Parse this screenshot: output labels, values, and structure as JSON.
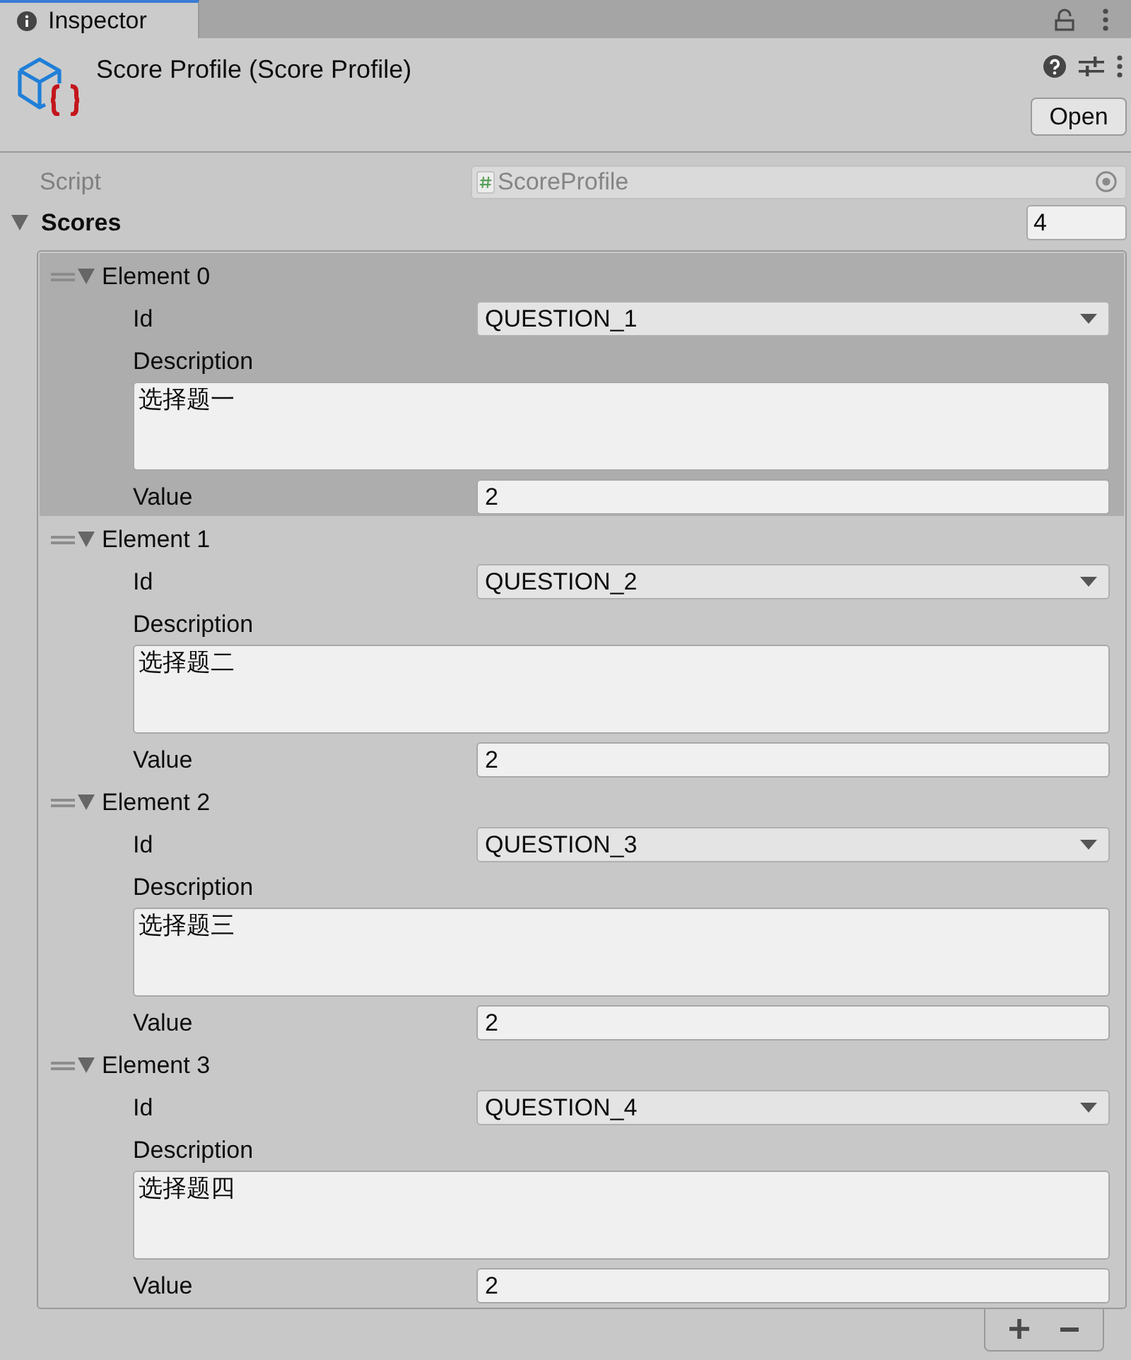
{
  "tab": {
    "label": "Inspector",
    "selected": true
  },
  "header": {
    "title": "Score Profile (Score Profile)",
    "open_button": "Open"
  },
  "script": {
    "label": "Script",
    "value": "ScoreProfile",
    "disabled": true
  },
  "scores": {
    "label": "Scores",
    "expanded": true,
    "size": "4",
    "elements": [
      {
        "label": "Element 0",
        "selected": true,
        "expanded": true,
        "id_label": "Id",
        "id": "QUESTION_1",
        "description_label": "Description",
        "description": "选择题一",
        "value_label": "Value",
        "value": "2"
      },
      {
        "label": "Element 1",
        "selected": false,
        "expanded": true,
        "id_label": "Id",
        "id": "QUESTION_2",
        "description_label": "Description",
        "description": "选择题二",
        "value_label": "Value",
        "value": "2"
      },
      {
        "label": "Element 2",
        "selected": false,
        "expanded": true,
        "id_label": "Id",
        "id": "QUESTION_3",
        "description_label": "Description",
        "description": "选择题三",
        "value_label": "Value",
        "value": "2"
      },
      {
        "label": "Element 3",
        "selected": false,
        "expanded": true,
        "id_label": "Id",
        "id": "QUESTION_4",
        "description_label": "Description",
        "description": "选择题四",
        "value_label": "Value",
        "value": "2"
      }
    ]
  }
}
